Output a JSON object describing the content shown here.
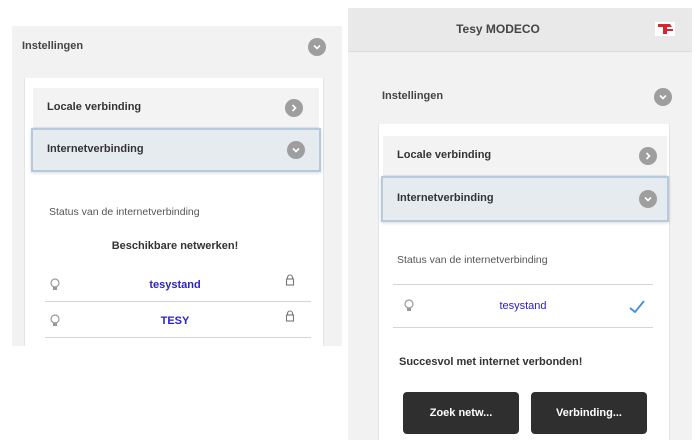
{
  "left_screen": {
    "settings_label": "Instellingen",
    "local_connection_label": "Locale verbinding",
    "internet_connection_label": "Internetverbinding",
    "status_text": "Status van de internetverbinding",
    "networks_heading": "Beschikbare netwerken!",
    "networks": [
      {
        "name": "tesystand",
        "icon": "lightbulb-icon",
        "lock_icon": "lock-icon"
      },
      {
        "name": "TESY",
        "icon": "lightbulb-icon",
        "lock_icon": "lock-icon"
      }
    ]
  },
  "right_screen": {
    "app_title": "Tesy MODECO",
    "logo_icon": "tesy-logo-icon",
    "settings_label": "Instellingen",
    "local_connection_label": "Locale verbinding",
    "internet_connection_label": "Internetverbinding",
    "status_text": "Status van de internetverbinding",
    "connected_network": {
      "name": "tesystand",
      "icon": "lightbulb-icon",
      "status_icon": "checkmark-icon"
    },
    "success_message": "Succesvol met internet verbonden!",
    "search_button_label": "Zoek netw...",
    "connection_button_label": "Verbinding..."
  },
  "colors": {
    "network_name": "#2b22c9",
    "checkmark": "#3d8fe0",
    "dark_button": "#2f2f2f",
    "active_row_border": "#b7c9dc",
    "logo_red": "#d9262c"
  }
}
